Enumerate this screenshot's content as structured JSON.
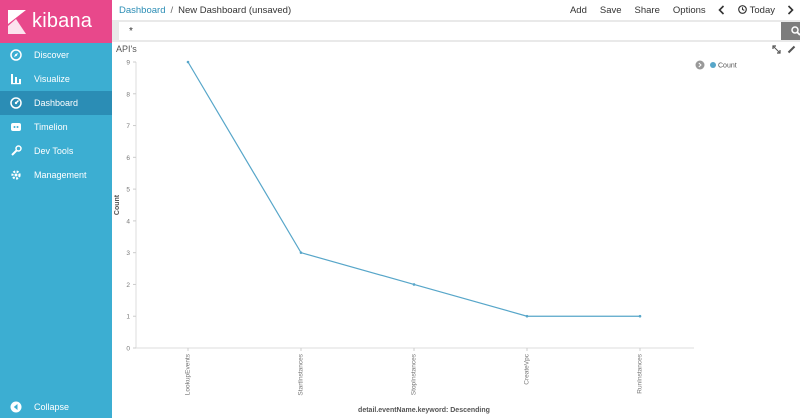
{
  "app": {
    "logo_text": "kibana"
  },
  "sidebar": {
    "items": [
      {
        "label": "Discover",
        "icon": "compass-icon"
      },
      {
        "label": "Visualize",
        "icon": "bar-chart-icon"
      },
      {
        "label": "Dashboard",
        "icon": "dashboard-icon",
        "active": true
      },
      {
        "label": "Timelion",
        "icon": "timelion-icon"
      },
      {
        "label": "Dev Tools",
        "icon": "wrench-icon"
      },
      {
        "label": "Management",
        "icon": "gear-icon"
      }
    ],
    "collapse_label": "Collapse"
  },
  "topbar": {
    "breadcrumb_root": "Dashboard",
    "breadcrumb_sep": "/",
    "breadcrumb_current": "New Dashboard (unsaved)",
    "add": "Add",
    "save": "Save",
    "share": "Share",
    "options": "Options",
    "time": "Today"
  },
  "search": {
    "value": "*"
  },
  "panel": {
    "title": "API's"
  },
  "colors": {
    "sidebar": "#3caed2",
    "logo_bg": "#e8488b",
    "active": "#2b8db5",
    "series": "#57a6c9"
  },
  "chart_data": {
    "type": "line",
    "categories": [
      "LookupEvents",
      "StartInstances",
      "StopInstances",
      "CreateVpc",
      "RunInstances"
    ],
    "series": [
      {
        "name": "Count",
        "values": [
          9,
          3,
          2,
          1,
          1
        ]
      }
    ],
    "xlabel": "detail.eventName.keyword: Descending",
    "ylabel": "Count",
    "ylim": [
      0,
      9
    ],
    "yticks": [
      "0",
      "1",
      "2",
      "3",
      "4",
      "5",
      "6",
      "7",
      "8",
      "9"
    ],
    "legend": "top-right"
  }
}
